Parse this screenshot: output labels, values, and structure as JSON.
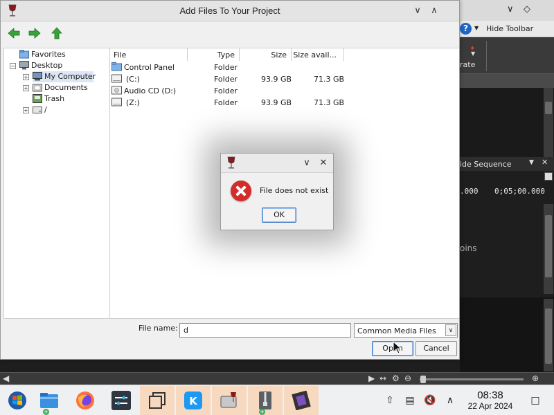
{
  "background_app": {
    "hide_toolbar_label": "Hide Toolbar",
    "ribbon_partial_label": "rate",
    "hide_sequence_label": "ide Sequence",
    "timecode_left": ".000",
    "timecode_right": "0;05;00.000",
    "bins_partial_label": "oins"
  },
  "file_dialog": {
    "title": "Add Files To Your Project",
    "tree": [
      {
        "label": "Favorites"
      },
      {
        "label": "Desktop"
      },
      {
        "label": "My Computer"
      },
      {
        "label": "Documents"
      },
      {
        "label": "Trash"
      },
      {
        "label": "/"
      }
    ],
    "columns": [
      "File",
      "Type",
      "Size",
      "Size avail..."
    ],
    "files": [
      {
        "name": "Control Panel",
        "type": "Folder",
        "size": "",
        "avail": ""
      },
      {
        "name": "(C:)",
        "type": "Folder",
        "size": "93.9 GB",
        "avail": "71.3 GB"
      },
      {
        "name": "Audio CD (D:)",
        "type": "Folder",
        "size": "",
        "avail": ""
      },
      {
        "name": "(Z:)",
        "type": "Folder",
        "size": "93.9 GB",
        "avail": "71.3 GB"
      }
    ],
    "file_name_label": "File name:",
    "file_name_value": "d",
    "file_type_selected": "Common Media Files",
    "open_label": "Open",
    "cancel_label": "Cancel"
  },
  "message_box": {
    "text": "File does not exist",
    "ok_label": "OK"
  },
  "taskbar": {
    "apps": [
      {
        "name": "start-menu",
        "icon": "windows-logo-icon"
      },
      {
        "name": "file-manager",
        "icon": "folder-icon"
      },
      {
        "name": "firefox",
        "icon": "firefox-icon"
      },
      {
        "name": "system-settings",
        "icon": "sliders-icon"
      },
      {
        "name": "window-switcher",
        "icon": "stacked-windows-icon"
      },
      {
        "name": "kde-connect",
        "icon": "kde-icon"
      },
      {
        "name": "wine-program",
        "icon": "wine-glass-icon"
      },
      {
        "name": "archive-manager",
        "icon": "zip-icon"
      },
      {
        "name": "video-editor",
        "icon": "film-icon"
      }
    ],
    "time": "08:38",
    "date": "22 Apr 2024"
  },
  "colors": {
    "accent_blue": "#3c78c6",
    "error_red": "#d42b2b",
    "active_task": "#f7d9bf",
    "nav_arrow_green": "#3aa23a"
  }
}
